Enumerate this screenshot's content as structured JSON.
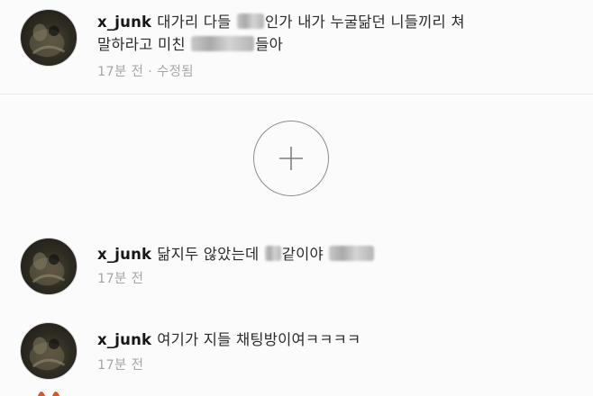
{
  "comments": [
    {
      "username": "x_junk",
      "text_before_blur1": "대가리 다들",
      "text_after_blur1": "인가 내가 누굴닮던 니들끼리 쳐",
      "text_line2_before_blur": "말하라고 미친",
      "text_line2_after_blur": "들아",
      "meta": "17분 전 · 수정됨"
    },
    {
      "username": "x_junk",
      "text_before_blur1": "닮지두 않았는데",
      "text_after_blur1": "같이야",
      "meta": "17분 전"
    },
    {
      "username": "x_junk",
      "text": "여기가 지들 채팅방이여ㅋㅋㅋㅋ",
      "meta": "17분 전"
    }
  ],
  "add_button": {
    "icon": "plus-icon"
  },
  "colors": {
    "background": "#fbfbfb",
    "meta_text": "#a6a6a6",
    "divider": "#e9e9e9",
    "circle_border": "#8b8b8b"
  }
}
